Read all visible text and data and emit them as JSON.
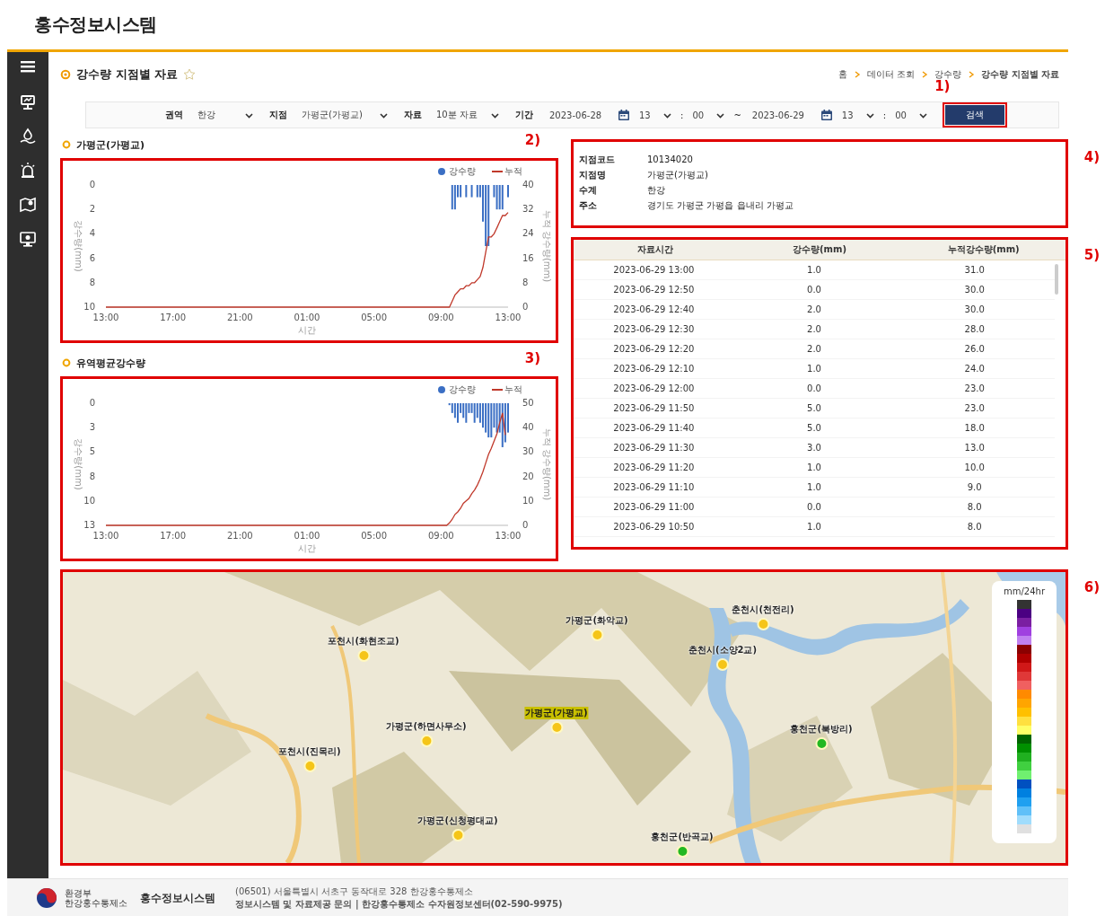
{
  "header": {
    "title": "홍수정보시스템"
  },
  "page": {
    "title": "강수량 지점별 자료",
    "favorite": false,
    "breadcrumb": [
      "홈",
      "데이터 조회",
      "강수량",
      "강수량 지점별 자료"
    ]
  },
  "filters": {
    "fields": [
      {
        "label": "권역",
        "kind": "select",
        "value": "한강"
      },
      {
        "label": "지점",
        "kind": "select",
        "value": "가평군(가평교)"
      },
      {
        "label": "자료",
        "kind": "select",
        "value": "10분 자료"
      }
    ],
    "period": {
      "label": "기간",
      "start": {
        "date": "2023-06-28",
        "hour": "13",
        "colon": ":",
        "minute": "00"
      },
      "separator": "~",
      "end": {
        "date": "2023-06-29",
        "hour": "13",
        "colon": ":",
        "minute": "00"
      }
    },
    "search_button": {
      "label": "검색",
      "annotation": "1)"
    }
  },
  "station_chart": {
    "title": "가평군(가평교)",
    "annotation": "2)",
    "rainfall": {
      "chart_data": {
        "type": "bar",
        "xlabel": "시간",
        "ylabel": "강수량(mm)",
        "categories": [
          "13:00",
          null,
          null,
          null,
          null,
          null,
          null,
          null,
          null,
          null,
          null,
          null,
          null,
          null,
          null,
          null,
          null,
          null,
          null,
          null,
          null,
          null,
          null,
          null,
          "17:00",
          null,
          null,
          null,
          null,
          null,
          null,
          null,
          null,
          null,
          null,
          null,
          null,
          null,
          null,
          null,
          null,
          null,
          null,
          null,
          null,
          null,
          null,
          null,
          "21:00",
          null,
          null,
          null,
          null,
          null,
          null,
          null,
          null,
          null,
          null,
          null,
          null,
          null,
          null,
          null,
          null,
          null,
          null,
          null,
          null,
          null,
          null,
          null,
          "01:00",
          null,
          null,
          null,
          null,
          null,
          null,
          null,
          null,
          null,
          null,
          null,
          null,
          null,
          null,
          null,
          null,
          null,
          null,
          null,
          null,
          null,
          null,
          null,
          "05:00",
          null,
          null,
          null,
          null,
          null,
          null,
          null,
          null,
          null,
          null,
          null,
          null,
          null,
          null,
          null,
          null,
          null,
          null,
          null,
          null,
          null,
          null,
          null,
          "09:00",
          null,
          null,
          null,
          null,
          null,
          null,
          null,
          null,
          null,
          null,
          null,
          null,
          null,
          null,
          null,
          null,
          null,
          null,
          null,
          null,
          null,
          null,
          null,
          "13:00"
        ],
        "ylim": [
          10,
          0
        ],
        "yticks": [
          0,
          2,
          4,
          6,
          8,
          10
        ],
        "series": [
          {
            "name": "강수량",
            "color": "#3b6fc4",
            "values": [
              0,
              0,
              0,
              0,
              0,
              0,
              0,
              0,
              0,
              0,
              0,
              0,
              0,
              0,
              0,
              0,
              0,
              0,
              0,
              0,
              0,
              0,
              0,
              0,
              0,
              0,
              0,
              0,
              0,
              0,
              0,
              0,
              0,
              0,
              0,
              0,
              0,
              0,
              0,
              0,
              0,
              0,
              0,
              0,
              0,
              0,
              0,
              0,
              0,
              0,
              0,
              0,
              0,
              0,
              0,
              0,
              0,
              0,
              0,
              0,
              0,
              0,
              0,
              0,
              0,
              0,
              0,
              0,
              0,
              0,
              0,
              0,
              0,
              0,
              0,
              0,
              0,
              0,
              0,
              0,
              0,
              0,
              0,
              0,
              0,
              0,
              0,
              0,
              0,
              0,
              0,
              0,
              0,
              0,
              0,
              0,
              0,
              0,
              0,
              0,
              0,
              0,
              0,
              0,
              0,
              0,
              0,
              0,
              0,
              0,
              0,
              0,
              0,
              0,
              0,
              0,
              0,
              0,
              0,
              0,
              0,
              0,
              0,
              0,
              2,
              2,
              1,
              1,
              0,
              1,
              0,
              1,
              0,
              1,
              1,
              3,
              5,
              5,
              0,
              1,
              2,
              2,
              2,
              0,
              1
            ]
          }
        ]
      }
    },
    "cumulative": {
      "chart_data": {
        "type": "line",
        "ylabel": "누적 강수량(mm)",
        "ylim": [
          0,
          40
        ],
        "yticks": [
          0,
          8,
          16,
          24,
          32,
          40
        ],
        "series": [
          {
            "name": "누적",
            "color": "#c0392b",
            "values": [
              0,
              0,
              0,
              0,
              0,
              0,
              0,
              0,
              0,
              0,
              0,
              0,
              0,
              0,
              0,
              0,
              0,
              0,
              0,
              0,
              0,
              0,
              0,
              0,
              0,
              0,
              0,
              0,
              0,
              0,
              0,
              0,
              0,
              0,
              0,
              0,
              0,
              0,
              0,
              0,
              0,
              0,
              0,
              0,
              0,
              0,
              0,
              0,
              0,
              0,
              0,
              0,
              0,
              0,
              0,
              0,
              0,
              0,
              0,
              0,
              0,
              0,
              0,
              0,
              0,
              0,
              0,
              0,
              0,
              0,
              0,
              0,
              0,
              0,
              0,
              0,
              0,
              0,
              0,
              0,
              0,
              0,
              0,
              0,
              0,
              0,
              0,
              0,
              0,
              0,
              0,
              0,
              0,
              0,
              0,
              0,
              0,
              0,
              0,
              0,
              0,
              0,
              0,
              0,
              0,
              0,
              0,
              0,
              0,
              0,
              0,
              0,
              0,
              0,
              0,
              0,
              0,
              0,
              0,
              0,
              0,
              0,
              0,
              0,
              2,
              4,
              5,
              6,
              6,
              7,
              7,
              8,
              8,
              9,
              10,
              13,
              18,
              23,
              23,
              24,
              26,
              28,
              30,
              30,
              31
            ]
          }
        ]
      }
    }
  },
  "basin_chart": {
    "title": "유역평균강수량",
    "annotation": "3)",
    "rainfall": {
      "chart_data": {
        "type": "bar",
        "xlabel": "시간",
        "ylabel": "강수량(mm)",
        "categories": [
          "13:00",
          null,
          null,
          null,
          null,
          null,
          null,
          null,
          null,
          null,
          null,
          null,
          null,
          null,
          null,
          null,
          null,
          null,
          null,
          null,
          null,
          null,
          null,
          null,
          "17:00",
          null,
          null,
          null,
          null,
          null,
          null,
          null,
          null,
          null,
          null,
          null,
          null,
          null,
          null,
          null,
          null,
          null,
          null,
          null,
          null,
          null,
          null,
          null,
          "21:00",
          null,
          null,
          null,
          null,
          null,
          null,
          null,
          null,
          null,
          null,
          null,
          null,
          null,
          null,
          null,
          null,
          null,
          null,
          null,
          null,
          null,
          null,
          null,
          "01:00",
          null,
          null,
          null,
          null,
          null,
          null,
          null,
          null,
          null,
          null,
          null,
          null,
          null,
          null,
          null,
          null,
          null,
          null,
          null,
          null,
          null,
          null,
          null,
          "05:00",
          null,
          null,
          null,
          null,
          null,
          null,
          null,
          null,
          null,
          null,
          null,
          null,
          null,
          null,
          null,
          null,
          null,
          null,
          null,
          null,
          null,
          null,
          null,
          "09:00",
          null,
          null,
          null,
          null,
          null,
          null,
          null,
          null,
          null,
          null,
          null,
          null,
          null,
          null,
          null,
          null,
          null,
          null,
          null,
          null,
          null,
          null,
          null,
          "13:00"
        ],
        "ylim": [
          12.5,
          0
        ],
        "yticks": [
          {
            "value": 0,
            "label": "0"
          },
          {
            "value": 2.5,
            "label": "3"
          },
          {
            "value": 5,
            "label": "5"
          },
          {
            "value": 7.5,
            "label": "8"
          },
          {
            "value": 10,
            "label": "10"
          },
          {
            "value": 12.5,
            "label": "13"
          }
        ],
        "series": [
          {
            "name": "강수량",
            "color": "#3b6fc4",
            "values": [
              0,
              0,
              0,
              0,
              0,
              0,
              0,
              0,
              0,
              0,
              0,
              0,
              0,
              0,
              0,
              0,
              0,
              0,
              0,
              0,
              0,
              0,
              0,
              0,
              0,
              0,
              0,
              0,
              0,
              0,
              0,
              0,
              0,
              0,
              0,
              0,
              0,
              0,
              0,
              0,
              0,
              0,
              0,
              0,
              0,
              0,
              0,
              0,
              0,
              0,
              0,
              0,
              0,
              0,
              0,
              0,
              0,
              0,
              0,
              0,
              0,
              0,
              0,
              0,
              0,
              0,
              0,
              0,
              0,
              0,
              0,
              0,
              0,
              0,
              0,
              0,
              0,
              0,
              0,
              0,
              0,
              0,
              0,
              0,
              0,
              0,
              0,
              0,
              0,
              0,
              0,
              0,
              0,
              0,
              0,
              0,
              0,
              0,
              0,
              0,
              0,
              0,
              0,
              0,
              0,
              0,
              0,
              0,
              0,
              0,
              0,
              0,
              0,
              0,
              0,
              0,
              0,
              0,
              0,
              0,
              0,
              0,
              0,
              0.2,
              1,
              1.5,
              2,
              1,
              1.5,
              2,
              1,
              1,
              2,
              1.5,
              2,
              2.5,
              3,
              3.5,
              3.5,
              2.5,
              3,
              3,
              4.5,
              4,
              3
            ]
          }
        ]
      }
    },
    "cumulative": {
      "chart_data": {
        "type": "line",
        "ylabel": "누적 강수량(mm)",
        "ylim": [
          0,
          50
        ],
        "yticks": [
          0,
          10,
          20,
          30,
          40,
          50
        ],
        "series": [
          {
            "name": "누적",
            "color": "#c0392b",
            "values": [
              0,
              0,
              0,
              0,
              0,
              0,
              0,
              0,
              0,
              0,
              0,
              0,
              0,
              0,
              0,
              0,
              0,
              0,
              0,
              0,
              0,
              0,
              0,
              0,
              0,
              0,
              0,
              0,
              0,
              0,
              0,
              0,
              0,
              0,
              0,
              0,
              0,
              0,
              0,
              0,
              0,
              0,
              0,
              0,
              0,
              0,
              0,
              0,
              0,
              0,
              0,
              0,
              0,
              0,
              0,
              0,
              0,
              0,
              0,
              0,
              0,
              0,
              0,
              0,
              0,
              0,
              0,
              0,
              0,
              0,
              0,
              0,
              0,
              0,
              0,
              0,
              0,
              0,
              0,
              0,
              0,
              0,
              0,
              0,
              0,
              0,
              0,
              0,
              0,
              0,
              0,
              0,
              0,
              0,
              0,
              0,
              0,
              0,
              0,
              0,
              0,
              0,
              0,
              0,
              0,
              0,
              0,
              0,
              0,
              0,
              0,
              0,
              0,
              0,
              0,
              0,
              0,
              0,
              0,
              0,
              0,
              0,
              0,
              1,
              2.5,
              4.5,
              5.5,
              7,
              9,
              10,
              11,
              13,
              14.5,
              16.5,
              19,
              22,
              25.5,
              29,
              31.5,
              34.5,
              37.5,
              42,
              46,
              37
            ]
          }
        ]
      }
    }
  },
  "station_info": {
    "annotation": "4)",
    "fields": [
      {
        "label": "지점코드",
        "value": "10134020"
      },
      {
        "label": "지점명",
        "value": "가평군(가평교)"
      },
      {
        "label": "수계",
        "value": "한강"
      },
      {
        "label": "주소",
        "value": "경기도 가평군 가평읍 읍내리 가평교"
      }
    ]
  },
  "data_table": {
    "annotation": "5)",
    "columns": [
      "자료시간",
      "강수량(mm)",
      "누적강수량(mm)"
    ],
    "rows": [
      [
        "2023-06-29 13:00",
        "1.0",
        "31.0"
      ],
      [
        "2023-06-29 12:50",
        "0.0",
        "30.0"
      ],
      [
        "2023-06-29 12:40",
        "2.0",
        "30.0"
      ],
      [
        "2023-06-29 12:30",
        "2.0",
        "28.0"
      ],
      [
        "2023-06-29 12:20",
        "2.0",
        "26.0"
      ],
      [
        "2023-06-29 12:10",
        "1.0",
        "24.0"
      ],
      [
        "2023-06-29 12:00",
        "0.0",
        "23.0"
      ],
      [
        "2023-06-29 11:50",
        "5.0",
        "23.0"
      ],
      [
        "2023-06-29 11:40",
        "5.0",
        "18.0"
      ],
      [
        "2023-06-29 11:30",
        "3.0",
        "13.0"
      ],
      [
        "2023-06-29 11:20",
        "1.0",
        "10.0"
      ],
      [
        "2023-06-29 11:10",
        "1.0",
        "9.0"
      ],
      [
        "2023-06-29 11:00",
        "0.0",
        "8.0"
      ],
      [
        "2023-06-29 10:50",
        "1.0",
        "8.0"
      ]
    ]
  },
  "map": {
    "annotation": "6)",
    "kind": "picture",
    "legend": {
      "title": "mm/24hr"
    },
    "stations": [
      {
        "name": "포천시(화현조교)",
        "color": "#f5c518",
        "selected": false
      },
      {
        "name": "가평군(화악교)",
        "color": "#f5c518",
        "selected": false
      },
      {
        "name": "춘천시(천전리)",
        "color": "#f5c518",
        "selected": false
      },
      {
        "name": "춘천시(소양2교)",
        "color": "#f5c518",
        "selected": false
      },
      {
        "name": "가평군(가평교)",
        "color": "#f5c518",
        "selected": true
      },
      {
        "name": "가평군(하면사무소)",
        "color": "#f5c518",
        "selected": false
      },
      {
        "name": "홍천군(북방리)",
        "color": "#22b822",
        "selected": false
      },
      {
        "name": "포천시(진목리)",
        "color": "#f5c518",
        "selected": false
      },
      {
        "name": "가평군(신청평대교)",
        "color": "#f5c518",
        "selected": false
      },
      {
        "name": "홍천군(반곡교)",
        "color": "#22b822",
        "selected": false
      }
    ]
  },
  "footer": {
    "ministry": "환경부",
    "agency": "한강홍수통제소",
    "system": "홍수정보시스템",
    "address": "(06501) 서울특별시 서초구 동작대로 328 한강홍수통제소",
    "contact": "정보시스템 및 자료제공 문의 | 한강홍수통제소 수자원정보센터(02-590-9975)"
  }
}
